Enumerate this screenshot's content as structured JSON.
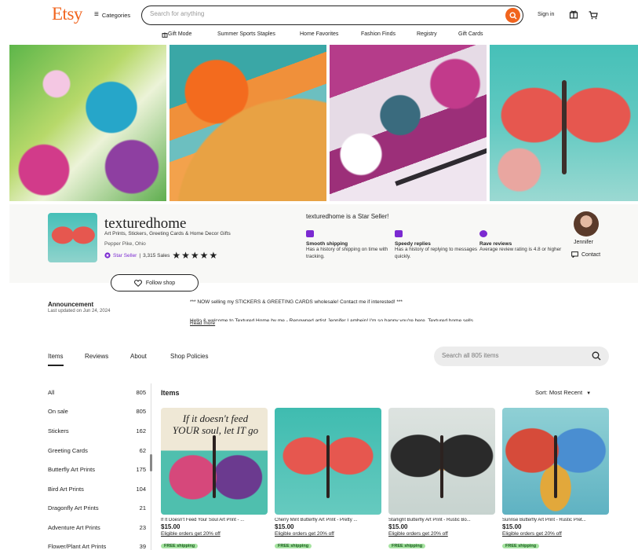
{
  "header": {
    "logo": "Etsy",
    "categories_label": "Categories",
    "search_placeholder": "Search for anything",
    "signin_label": "Sign in"
  },
  "subnav": [
    "Gift Mode",
    "Summer Sports Staples",
    "Home Favorites",
    "Fashion Finds",
    "Registry",
    "Gift Cards"
  ],
  "shop": {
    "name": "texturedhome",
    "tagline": "Art Prints, Stickers, Greeting Cards & Home Decor Gifts",
    "location": "Pepper Pike, Ohio",
    "star_seller": "Star Seller",
    "sales": "3,315 Sales",
    "stars": "★★★★★",
    "star_heading": "texturedhome is a Star Seller!",
    "perks": [
      {
        "title": "Smooth shipping",
        "desc": "Has a history of shipping on time with tracking."
      },
      {
        "title": "Speedy replies",
        "desc": "Has a history of replying to messages quickly."
      },
      {
        "title": "Rave reviews",
        "desc": "Average review rating is 4.8 or higher"
      }
    ],
    "owner_name": "Jennifer",
    "contact_label": "Contact",
    "follow_label": "Follow shop"
  },
  "announcement": {
    "title": "Announcement",
    "date": "Last updated on Jun 24, 2024",
    "text": "*** NOW selling my STICKERS & GREETING CARDS wholesale! Contact me if interested! ***",
    "text2": "Hello & welcome to Textured Home by me - Renowned artist Jennifer Lambein! I'm so happy you're here. Textured home sells",
    "read_more": "Read more"
  },
  "tabs": [
    "Items",
    "Reviews",
    "About",
    "Shop Policies"
  ],
  "shop_search_placeholder": "Search all 805 items",
  "sidebar": [
    {
      "label": "All",
      "count": "805"
    },
    {
      "label": "On sale",
      "count": "805"
    },
    {
      "label": "Stickers",
      "count": "162"
    },
    {
      "label": "Greeting Cards",
      "count": "62"
    },
    {
      "label": "Butterfly Art Prints",
      "count": "175"
    },
    {
      "label": "Bird Art Prints",
      "count": "104"
    },
    {
      "label": "Dragonfly Art Prints",
      "count": "21"
    },
    {
      "label": "Adventure Art Prints",
      "count": "23"
    },
    {
      "label": "Flower/Plant Art Prints",
      "count": "39"
    }
  ],
  "items_heading": "Items",
  "sort_label": "Sort: Most Recent",
  "products": [
    {
      "title": "If It Doesn't Feed Your Soul Art Print - ...",
      "price": "$15.00",
      "promo": "Eligible orders get 20% off",
      "shipping": "FREE shipping",
      "image_text": "If it doesn't feed YOUR soul, let IT go"
    },
    {
      "title": "Cherry Mint Butterfly Art Print - Pretty ...",
      "price": "$15.00",
      "promo": "Eligible orders get 20% off",
      "shipping": "FREE shipping"
    },
    {
      "title": "Starlight Butterfly Art Print - Rustic Bo...",
      "price": "$15.00",
      "promo": "Eligible orders get 20% off",
      "shipping": "FREE shipping"
    },
    {
      "title": "Sunrise Butterfly Art Print - Rustic Pret...",
      "price": "$15.00",
      "promo": "Eligible orders get 20% off",
      "shipping": "FREE shipping"
    }
  ],
  "colors": {
    "brand": "#f1641e",
    "star_seller": "#7b2ad1",
    "free_shipping_bg": "#a6e3a1"
  }
}
